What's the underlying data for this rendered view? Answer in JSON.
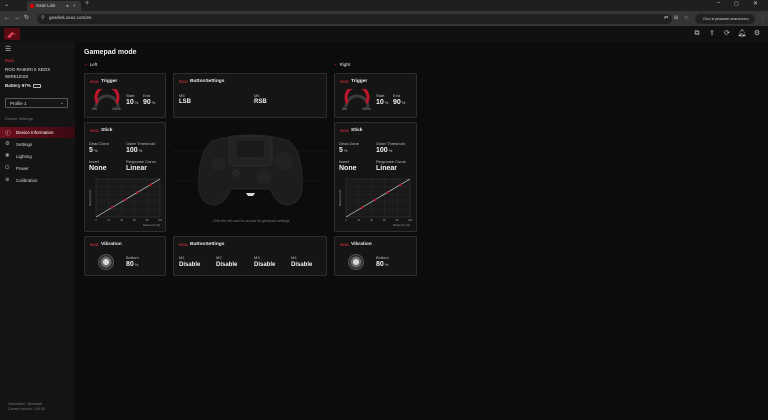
{
  "browser": {
    "tab_title": "Gear Link",
    "url": "gearlink.asus.com/en",
    "incognito_label": "Оно в режиме инкогнито"
  },
  "app": {
    "logo_icon": "rog-logo-icon",
    "header_icons": [
      "window-icon",
      "share-icon",
      "refresh-icon",
      "bell-icon",
      "gear-icon"
    ]
  },
  "sidebar": {
    "brand": "ROG",
    "device_name": "ROG RAIKIRI II XBOX WIRELESS",
    "battery_label": "Battery 97%",
    "profile_value": "Profile 1",
    "section_heading": "Device Settings",
    "items": [
      {
        "label": "Device Information",
        "icon": "info-icon",
        "active": true
      },
      {
        "label": "Settings",
        "icon": "settings-icon",
        "active": false
      },
      {
        "label": "Lighting",
        "icon": "light-icon",
        "active": false
      },
      {
        "label": "Power",
        "icon": "power-icon",
        "active": false
      },
      {
        "label": "Calibration",
        "icon": "calibration-icon",
        "active": false
      }
    ],
    "footer": "Connection : Bluetooth\nCurrent Version: 1.00.05"
  },
  "main": {
    "title": "Gamepad mode",
    "left_label": "Left",
    "right_label": "Right",
    "hint": "Click the info card to access its gamepad settings",
    "left_trigger": {
      "title": "Trigger",
      "start_label": "Start",
      "end_label": "End",
      "start_value": "10",
      "end_value": "90",
      "unit": "%",
      "gauge_min": "0%",
      "gauge_max": "100%"
    },
    "right_trigger": {
      "title": "Trigger",
      "start_label": "Start",
      "end_label": "End",
      "start_value": "10",
      "end_value": "90",
      "unit": "%",
      "gauge_min": "0%",
      "gauge_max": "100%"
    },
    "button_settings_top": {
      "title": "ButtonSettings",
      "m5_label": "M5",
      "m5_value": "LSB",
      "m6_label": "M6",
      "m6_value": "RSB"
    },
    "left_stick": {
      "title": "Stick",
      "dead_zone_label": "Dead Zone",
      "dead_zone_value": "5",
      "outer_label": "Outer Threshold",
      "outer_value": "100",
      "unit": "%",
      "invert_label": "Invert",
      "invert_value": "None",
      "curve_label": "Response Curve",
      "curve_value": "Linear",
      "y_axis": "Response (%)",
      "x_axis": "Movement (%)",
      "ticks": [
        "0",
        "20",
        "40",
        "60",
        "80",
        "100"
      ]
    },
    "right_stick": {
      "title": "Stick",
      "dead_zone_label": "Dead Zone",
      "dead_zone_value": "5",
      "outer_label": "Outer Threshold",
      "outer_value": "100",
      "unit": "%",
      "invert_label": "Invert",
      "invert_value": "None",
      "curve_label": "Response Curve",
      "curve_value": "Linear",
      "y_axis": "Response (%)",
      "x_axis": "Movement (%)",
      "ticks": [
        "0",
        "20",
        "40",
        "60",
        "80",
        "100"
      ]
    },
    "left_vibration": {
      "title": "Vibration",
      "label": "Bottom",
      "value": "80",
      "unit": "%"
    },
    "right_vibration": {
      "title": "Vibration",
      "label": "Bottom",
      "value": "80",
      "unit": "%"
    },
    "button_settings_bottom": {
      "title": "ButtonSettings",
      "items": [
        {
          "label": "M1",
          "value": "Disable"
        },
        {
          "label": "M2",
          "value": "Disable"
        },
        {
          "label": "M3",
          "value": "Disable"
        },
        {
          "label": "M4",
          "value": "Disable"
        }
      ]
    }
  }
}
